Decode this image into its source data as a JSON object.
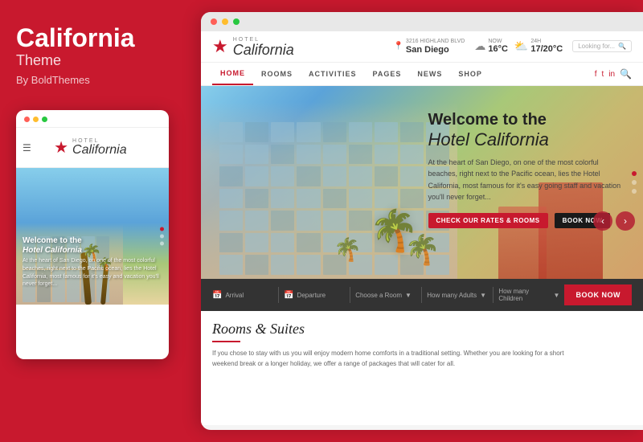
{
  "left": {
    "title": "California",
    "subtitle": "Theme",
    "author": "By BoldThemes",
    "mobile": {
      "logo_hotel": "HOTEL",
      "logo_name": "California",
      "hero_welcome": "Welcome to the",
      "hero_name": "Hotel California",
      "hero_desc": "At the heart of San Diego, on one of the most colorful beaches, right next to the Pacific ocean, lies the Hotel California, most famous for it's easy and vacation you'll never forget..."
    }
  },
  "right": {
    "browser_dots": [
      "red",
      "yellow",
      "green"
    ],
    "logo_hotel": "HOTEL",
    "logo_name": "California",
    "location_address": "3216 HIGHLAND BLVD",
    "location_city": "San Diego",
    "weather1_label": "NOW",
    "weather1_temp": "16°C",
    "weather2_label": "24H",
    "weather2_temp": "17/20°C",
    "search_placeholder": "Looking for...",
    "nav_items": [
      "HOME",
      "ROOMS",
      "ACTIVITIES",
      "PAGES",
      "NEWS",
      "SHOP"
    ],
    "hero_welcome": "Welcome to the",
    "hero_hotel": "Hotel California",
    "hero_desc": "At the heart of San Diego, on one of the most colorful beaches, right next to the Pacific ocean, lies the Hotel California, most famous for it's easy going staff and vacation you'll never forget...",
    "btn_check": "CHECK OUR RATES & ROOMS",
    "btn_book": "BOOK NOW",
    "booking": {
      "arrival": "Arrival",
      "departure": "Departure",
      "room": "Choose a Room",
      "adults": "How many Adults",
      "children": "How many Children",
      "book_btn": "BOOK NOW"
    },
    "rooms_title": "Rooms",
    "rooms_ampersand": "&",
    "rooms_subtitle": "Suites",
    "rooms_desc": "If you chose to stay with us you will enjoy modern home comforts in a traditional setting. Whether you are looking for a short weekend break or a longer holiday, we offer a range of packages that will cater for all."
  }
}
